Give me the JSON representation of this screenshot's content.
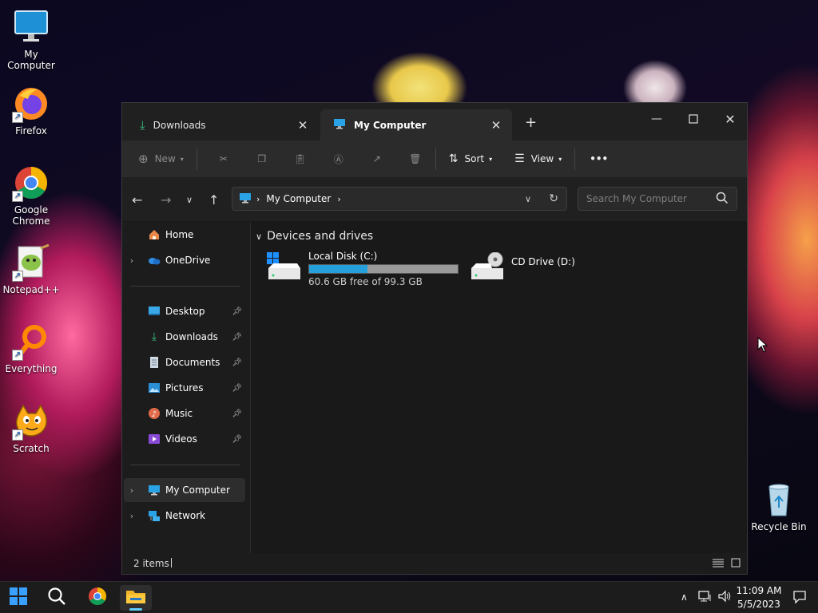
{
  "desktop": {
    "icons": [
      {
        "label": "My Computer"
      },
      {
        "label": "Firefox"
      },
      {
        "label": "Google Chrome"
      },
      {
        "label": "Notepad++"
      },
      {
        "label": "Everything"
      },
      {
        "label": "Scratch"
      },
      {
        "label": "Recycle Bin"
      }
    ]
  },
  "explorer": {
    "tabs": [
      {
        "label": "Downloads",
        "active": false
      },
      {
        "label": "My Computer",
        "active": true
      }
    ],
    "toolbar": {
      "new_label": "New",
      "sort_label": "Sort",
      "view_label": "View",
      "more_label": "•••"
    },
    "address": {
      "segments": [
        "My Computer"
      ]
    },
    "search": {
      "placeholder": "Search My Computer"
    },
    "sidebar": {
      "items": [
        {
          "label": "Home"
        },
        {
          "label": "OneDrive"
        },
        {
          "label": "Desktop"
        },
        {
          "label": "Downloads"
        },
        {
          "label": "Documents"
        },
        {
          "label": "Pictures"
        },
        {
          "label": "Music"
        },
        {
          "label": "Videos"
        },
        {
          "label": "My Computer"
        },
        {
          "label": "Network"
        }
      ]
    },
    "content": {
      "group_title": "Devices and drives",
      "drives": [
        {
          "name": "Local Disk (C:)",
          "free_text": "60.6 GB free of 99.3 GB",
          "used_fraction": 0.39
        },
        {
          "name": "CD Drive (D:)"
        }
      ]
    },
    "status": {
      "items_text": "2 items"
    }
  },
  "taskbar": {
    "time": "11:09 AM",
    "date": "5/5/2023"
  },
  "colors": {
    "accent": "#26a0da",
    "window_bg": "#191919",
    "toolbar_bg": "#2b2b2b"
  }
}
